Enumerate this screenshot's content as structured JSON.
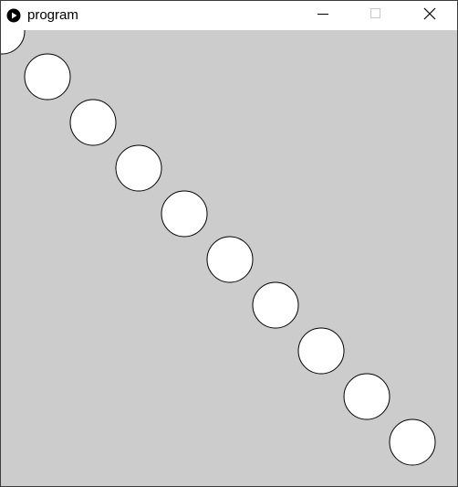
{
  "window": {
    "title": "program",
    "app_icon": "play-circle-icon",
    "controls": [
      "minimize-icon",
      "maximize-icon",
      "close-icon"
    ]
  },
  "canvas": {
    "background": "#cccccc",
    "circle_fill": "#ffffff",
    "circle_stroke": "#000000",
    "circle_count": 10
  }
}
